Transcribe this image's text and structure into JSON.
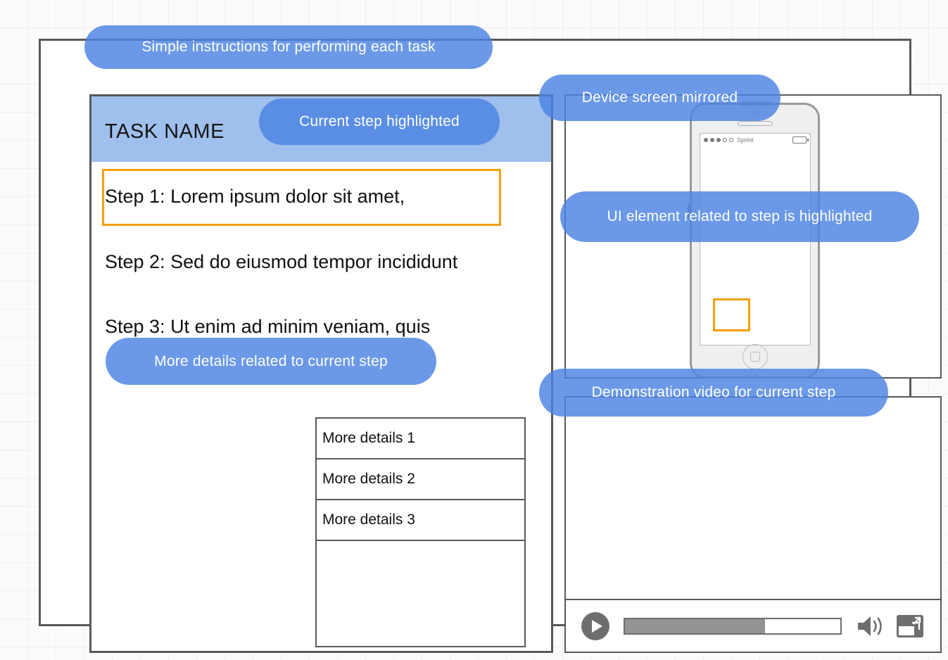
{
  "callouts": {
    "instructions": "Simple instructions for performing each task",
    "current_step": "Current step highlighted",
    "more_details": "More details related to current step",
    "device_mirror": "Device screen mirrored",
    "ui_highlight": "UI element related to step is highlighted",
    "demo_video": "Demonstration video for current step"
  },
  "left_panel": {
    "task_title": "TASK NAME",
    "steps": [
      {
        "label": "Step 1: Lorem ipsum dolor sit amet,",
        "highlighted": true
      },
      {
        "label": "Step 2: Sed do eiusmod tempor incididunt",
        "highlighted": false
      },
      {
        "label": "Step 3: Ut enim ad minim veniam, quis",
        "highlighted": false
      }
    ],
    "details_rows": [
      "More details 1",
      "More details 2",
      "More details 3"
    ]
  },
  "phone_panel": {
    "status_bar": {
      "carrier": "Sprint",
      "signal_dots": 5,
      "battery_icon": "battery-icon"
    },
    "highlight_box": "ui-element-highlight",
    "home_button": "home-button-icon"
  },
  "video_panel": {
    "play_icon": "play-icon",
    "progress_percent": 65,
    "volume_icon": "volume-icon",
    "fullscreen_icon": "fullscreen-icon"
  },
  "colors": {
    "callout_blue": "#4A83E2",
    "header_blue": "#9FC0EC",
    "highlight_orange": "#F2A007",
    "frame_gray": "#595959",
    "control_gray": "#6E6E6E",
    "progress_fill_gray": "#949494"
  }
}
